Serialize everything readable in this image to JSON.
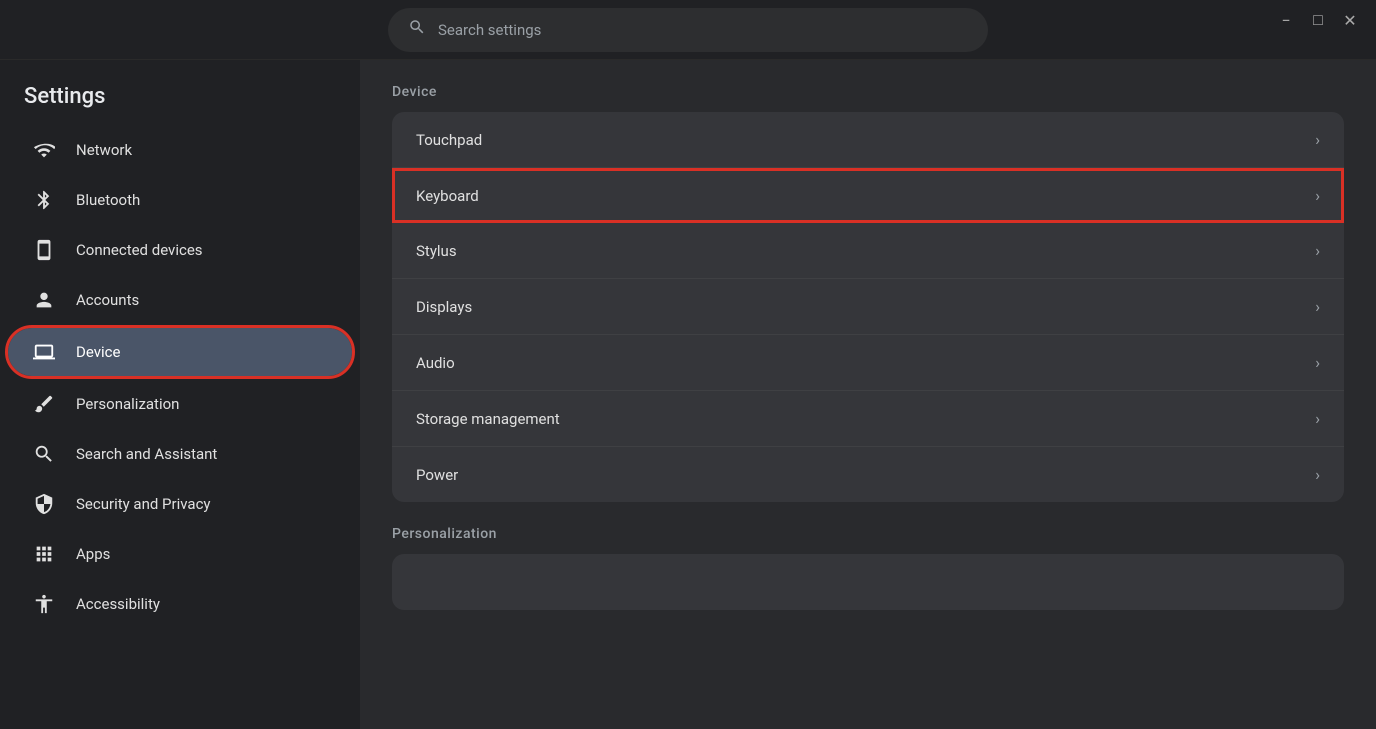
{
  "window": {
    "title": "Settings",
    "titlebar": {
      "minimize_label": "−",
      "maximize_label": "□",
      "close_label": "✕"
    }
  },
  "header": {
    "title": "Settings"
  },
  "search": {
    "placeholder": "Search settings"
  },
  "sidebar": {
    "items": [
      {
        "id": "network",
        "label": "Network",
        "icon": "wifi-icon",
        "active": false
      },
      {
        "id": "bluetooth",
        "label": "Bluetooth",
        "icon": "bluetooth-icon",
        "active": false
      },
      {
        "id": "connected-devices",
        "label": "Connected devices",
        "icon": "device-icon",
        "active": false
      },
      {
        "id": "accounts",
        "label": "Accounts",
        "icon": "person-icon",
        "active": false
      },
      {
        "id": "device",
        "label": "Device",
        "icon": "laptop-icon",
        "active": true
      },
      {
        "id": "personalization",
        "label": "Personalization",
        "icon": "brush-icon",
        "active": false
      },
      {
        "id": "search-assistant",
        "label": "Search and Assistant",
        "icon": "search-icon",
        "active": false
      },
      {
        "id": "security-privacy",
        "label": "Security and Privacy",
        "icon": "shield-icon",
        "active": false
      },
      {
        "id": "apps",
        "label": "Apps",
        "icon": "apps-icon",
        "active": false
      },
      {
        "id": "accessibility",
        "label": "Accessibility",
        "icon": "accessibility-icon",
        "active": false
      }
    ]
  },
  "content": {
    "sections": [
      {
        "title": "Device",
        "items": [
          {
            "label": "Touchpad",
            "highlighted": false
          },
          {
            "label": "Keyboard",
            "highlighted": true
          },
          {
            "label": "Stylus",
            "highlighted": false
          },
          {
            "label": "Displays",
            "highlighted": false
          },
          {
            "label": "Audio",
            "highlighted": false
          },
          {
            "label": "Storage management",
            "highlighted": false
          },
          {
            "label": "Power",
            "highlighted": false
          }
        ]
      },
      {
        "title": "Personalization",
        "items": []
      }
    ]
  }
}
